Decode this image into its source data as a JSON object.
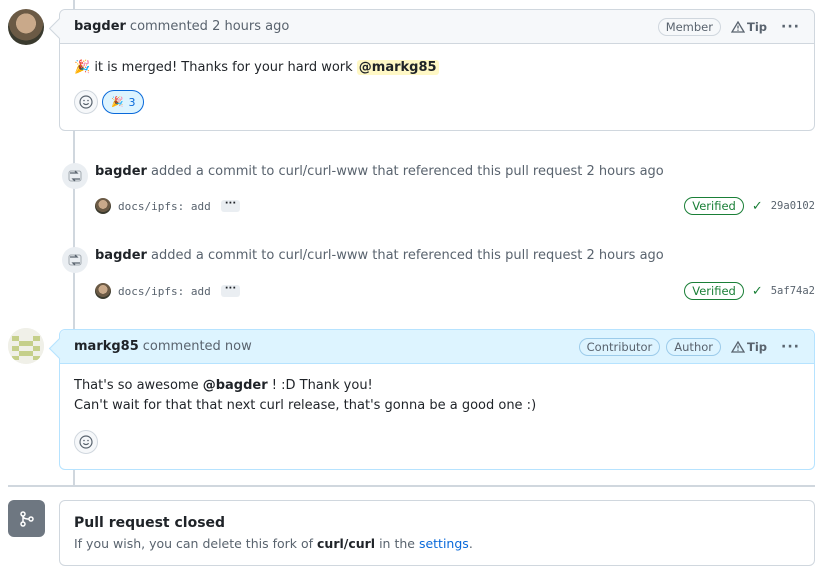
{
  "comment1": {
    "author": "bagder",
    "meta": "commented 2 hours ago",
    "badge": "Member",
    "tip": "Tip",
    "body_emoji": "🎉",
    "body_text": " it is merged! Thanks for your hard work ",
    "mention": "@markg85",
    "reaction_emoji": "🎉",
    "reaction_count": "3"
  },
  "events": [
    {
      "actor": "bagder",
      "text": " added a commit to curl/curl-www that referenced this pull request 2 hours ago",
      "commit_msg": "docs/ipfs: add",
      "verified": "Verified",
      "sha": "29a0102"
    },
    {
      "actor": "bagder",
      "text": " added a commit to curl/curl-www that referenced this pull request 2 hours ago",
      "commit_msg": "docs/ipfs: add",
      "verified": "Verified",
      "sha": "5af74a2"
    }
  ],
  "comment2": {
    "author": "markg85",
    "meta": "commented now",
    "badge1": "Contributor",
    "badge2": "Author",
    "tip": "Tip",
    "line1_pre": "That's so awesome ",
    "mention": "@bagder",
    "line1_post": " ! :D Thank you!",
    "line2": "Can't wait for that that next curl release, that's gonna be a good one :)"
  },
  "closed": {
    "title": "Pull request closed",
    "text_pre": "If you wish, you can delete this fork of ",
    "repo": "curl/curl",
    "text_mid": " in the ",
    "link": "settings",
    "text_post": "."
  },
  "colors": {
    "accent": "#0969da",
    "verified": "#1a7f37",
    "author_header": "#ddf4ff",
    "mention_highlight": "#fff8c5"
  }
}
